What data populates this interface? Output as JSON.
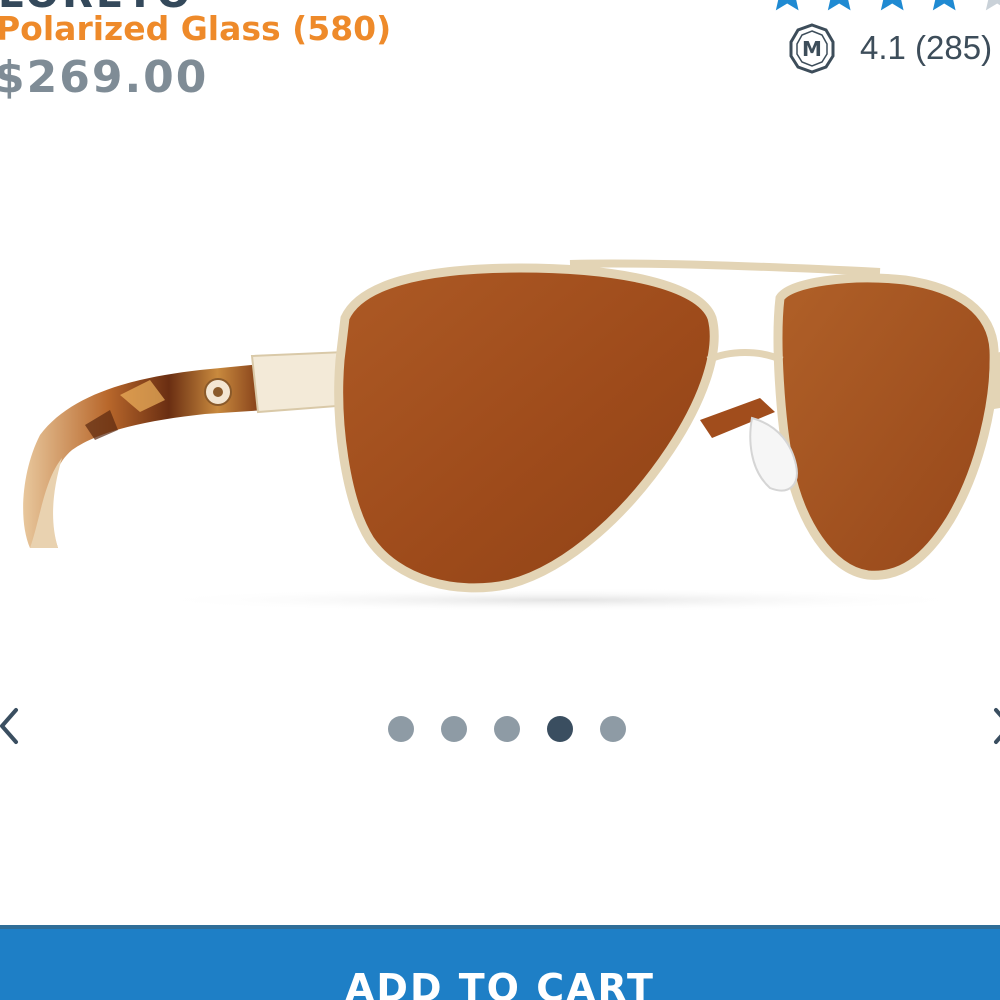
{
  "product": {
    "name": "LORETO",
    "lens_option": "Polarized Glass (580)",
    "price": "$269.00"
  },
  "rating": {
    "stars_filled": 4,
    "stars_total": 5,
    "badge_letter": "M",
    "text": "4.1 (285)"
  },
  "carousel": {
    "image": "sunglasses-product-photo",
    "slides": 5,
    "active_index": 3,
    "prev_icon": "chevron-left-icon",
    "next_icon": "chevron-right-icon"
  },
  "cart": {
    "button_label": "ADD TO CART"
  },
  "colors": {
    "accent_orange": "#ee8a2a",
    "cart_blue": "#1e7fc6",
    "star_blue": "#1f8ad2",
    "star_empty": "#c9d1d8",
    "dot_inactive": "#8e9ba5",
    "dot_active": "#3a4e60",
    "price_gray": "#7f8c96",
    "lens_copper": "#a6501f"
  }
}
